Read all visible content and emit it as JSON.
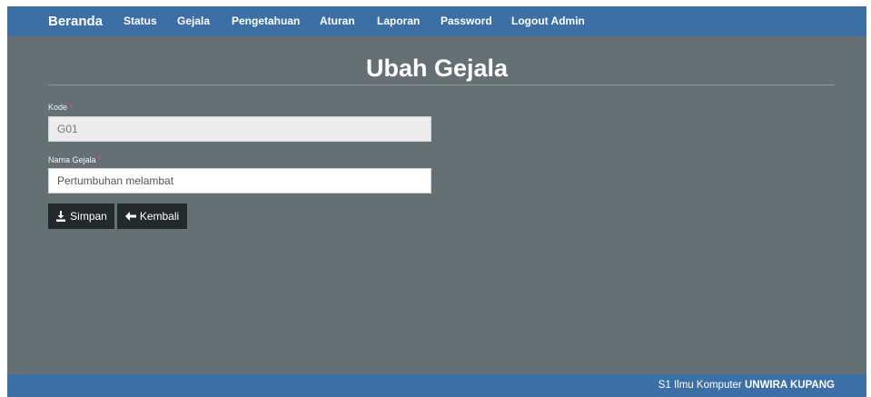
{
  "nav": {
    "brand": "Beranda",
    "items": [
      "Status",
      "Gejala",
      "Pengetahuan",
      "Aturan",
      "Laporan",
      "Password",
      "Logout Admin"
    ]
  },
  "page": {
    "title": "Ubah Gejala"
  },
  "form": {
    "kode_label": "Kode",
    "kode_value": "G01",
    "nama_label": "Nama Gejala",
    "nama_value": "Pertumbuhan melambat",
    "required_mark": "*"
  },
  "buttons": {
    "save": "Simpan",
    "back": "Kembali"
  },
  "footer": {
    "prefix": "S1 Ilmu Komputer",
    "org": "UNWIRA KUPANG"
  },
  "colors": {
    "navbar": "#3b6fa6",
    "background": "#657074",
    "button": "#24292b"
  }
}
